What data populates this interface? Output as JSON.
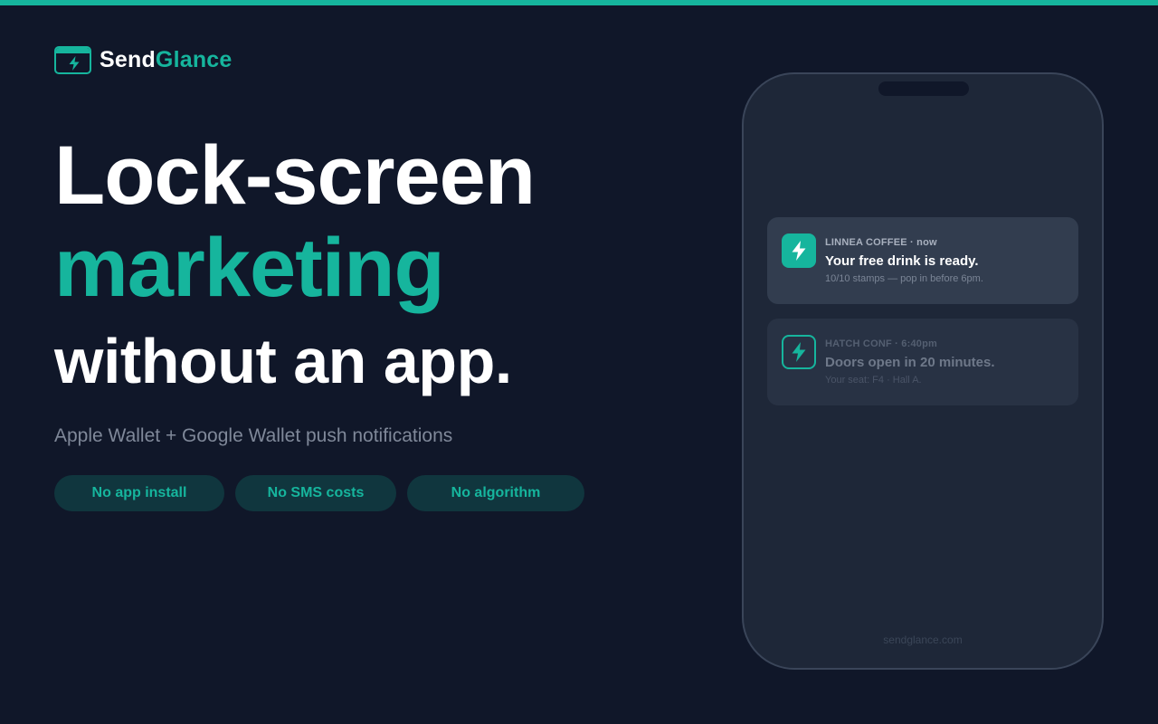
{
  "brand": {
    "name_part1": "Send",
    "name_part2": "Glance",
    "logo_icon": "bolt-icon"
  },
  "hero": {
    "line1": "Lock-screen",
    "line2": "marketing",
    "line3": "without an app.",
    "subtitle": "Apple Wallet + Google Wallet push notifications"
  },
  "pills": [
    {
      "label": "No app install"
    },
    {
      "label": "No SMS costs"
    },
    {
      "label": "No algorithm"
    }
  ],
  "phone": {
    "notifications": [
      {
        "meta": "LINNEA COFFEE · now",
        "title": "Your free drink is ready.",
        "body": "10/10 stamps — pop in before 6pm.",
        "icon": "bolt-icon"
      },
      {
        "meta": "HATCH CONF · 6:40pm",
        "title": "Doors open in 20 minutes.",
        "body": "Your seat: F4 · Hall A.",
        "icon": "bolt-icon"
      }
    ],
    "footer": "sendglance.com"
  },
  "colors": {
    "background": "#101729",
    "accent": "#16b59d",
    "phone_body": "#1e2738",
    "pill_background": "#10363e"
  }
}
